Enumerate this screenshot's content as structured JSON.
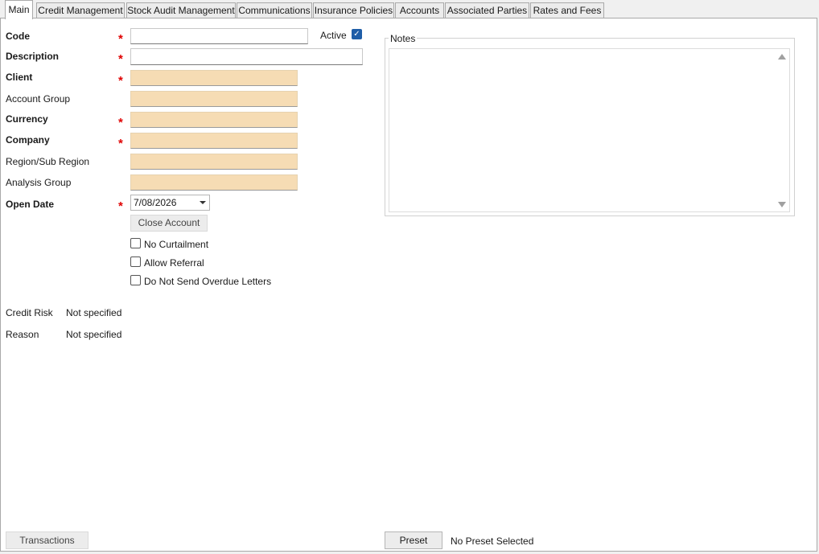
{
  "tabs": [
    {
      "label": "Main"
    },
    {
      "label": "Credit Management"
    },
    {
      "label": "Stock Audit Management"
    },
    {
      "label": "Communications"
    },
    {
      "label": "Insurance Policies"
    },
    {
      "label": "Accounts"
    },
    {
      "label": "Associated Parties"
    },
    {
      "label": "Rates and Fees"
    }
  ],
  "active_tab": "Main",
  "fields": {
    "code": {
      "label": "Code",
      "value": "",
      "required": true
    },
    "description": {
      "label": "Description",
      "value": "",
      "required": true
    },
    "client": {
      "label": "Client",
      "value": "",
      "required": true
    },
    "account_group": {
      "label": "Account Group",
      "value": "",
      "required": false
    },
    "currency": {
      "label": "Currency",
      "value": "",
      "required": true
    },
    "company": {
      "label": "Company",
      "value": "",
      "required": true
    },
    "region": {
      "label": "Region/Sub Region",
      "value": "",
      "required": false
    },
    "analysis_group": {
      "label": "Analysis Group",
      "value": "",
      "required": false
    },
    "open_date": {
      "label": "Open Date",
      "value": "7/08/2026",
      "required": true
    }
  },
  "required_marker": "*",
  "active": {
    "label": "Active",
    "checked": true
  },
  "checkmark": "✓",
  "close_account_label": "Close Account",
  "options": [
    {
      "label": "No Curtailment",
      "checked": false
    },
    {
      "label": "Allow Referral",
      "checked": false
    },
    {
      "label": "Do Not Send Overdue Letters",
      "checked": false
    }
  ],
  "credit_risk": {
    "label": "Credit Risk",
    "value": "Not specified"
  },
  "reason": {
    "label": "Reason",
    "value": "Not specified"
  },
  "notes": {
    "label": "Notes",
    "value": ""
  },
  "footer": {
    "transactions_label": "Transactions",
    "preset_label": "Preset",
    "preset_status": "No Preset Selected"
  },
  "colors": {
    "lookup_field_bg": "#f6dcb4",
    "required_marker": "#e00000",
    "checkbox_checked": "#1f5ea8"
  }
}
